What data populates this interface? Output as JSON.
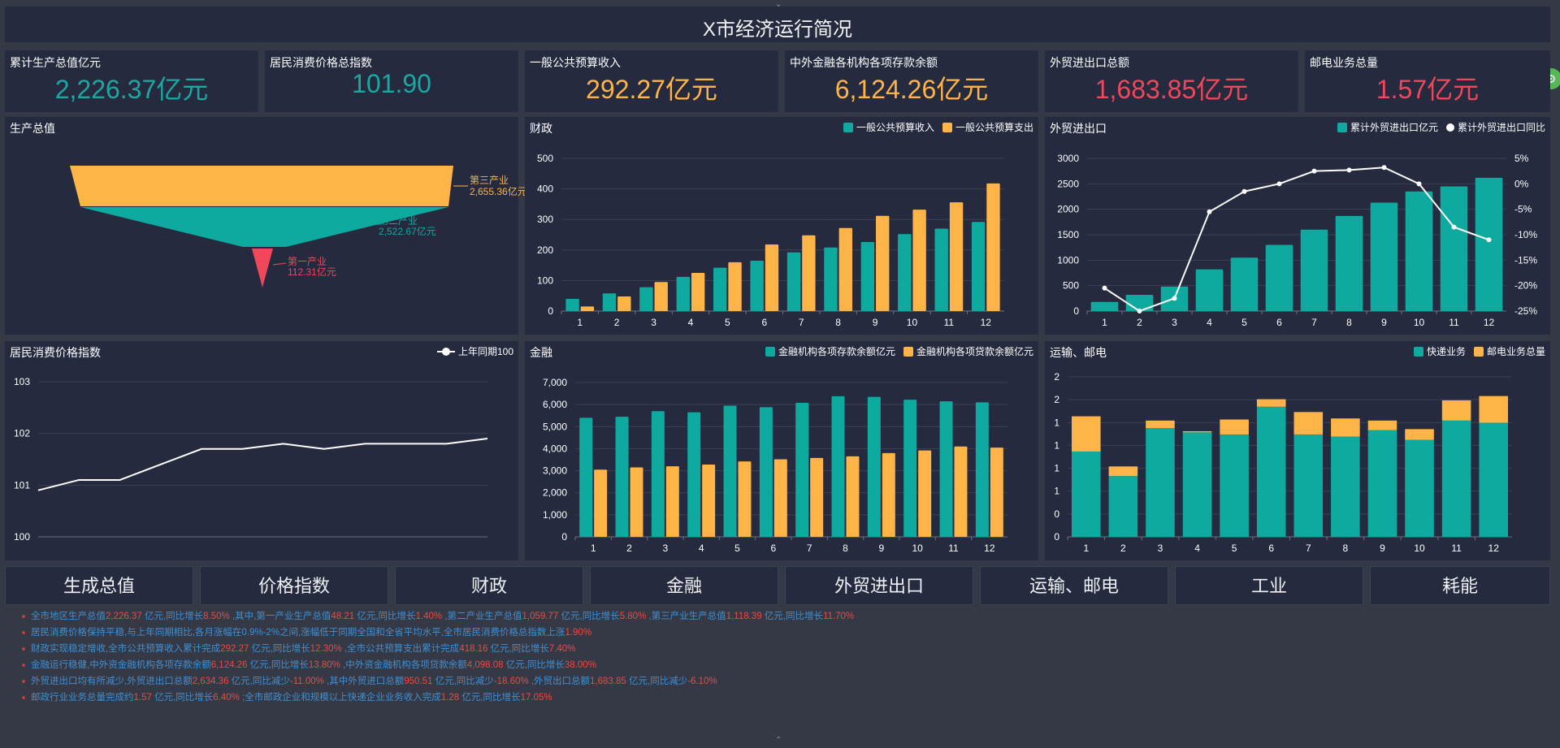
{
  "header": {
    "title": "X市经济运行简况"
  },
  "kpis": [
    {
      "label": "累计生产总值亿元",
      "value": "2,226.37亿元",
      "color": "#1aa8a0"
    },
    {
      "label": "居民消费价格总指数",
      "value": "101.90",
      "color": "#1aa8a0"
    },
    {
      "label": "一般公共预算收入",
      "value": "292.27亿元",
      "color": "#ffb447"
    },
    {
      "label": "中外金融各机构各项存款余额",
      "value": "6,124.26亿元",
      "color": "#ffb447"
    },
    {
      "label": "外贸进出口总额",
      "value": "1,683.85亿元",
      "color": "#f0475a"
    },
    {
      "label": "邮电业务总量",
      "value": "1.57亿元",
      "color": "#f0475a"
    }
  ],
  "colors": {
    "teal": "#0eaaa0",
    "orange": "#ffb447",
    "red": "#f0475a",
    "white": "#ffffff",
    "grid": "#3c4256"
  },
  "nav": [
    "生成总值",
    "价格指数",
    "财政",
    "金融",
    "外贸进出口",
    "运输、邮电",
    "工业",
    "耗能"
  ],
  "chart_data": [
    {
      "id": "gdp",
      "type": "funnel",
      "title": "生产总值",
      "stages": [
        {
          "name": "第三产业",
          "value": 2655.36,
          "label": "2,655.36亿元",
          "color": "#ffb447"
        },
        {
          "name": "第二产业",
          "value": 2522.67,
          "label": "2,522.67亿元",
          "color": "#0eaaa0"
        },
        {
          "name": "第一产业",
          "value": 112.31,
          "label": "112.31亿元",
          "color": "#f0475a"
        }
      ]
    },
    {
      "id": "finance",
      "type": "bar",
      "title": "财政",
      "categories": [
        "1",
        "2",
        "3",
        "4",
        "5",
        "6",
        "7",
        "8",
        "9",
        "10",
        "11",
        "12"
      ],
      "series": [
        {
          "name": "一般公共预算收入",
          "color": "#0eaaa0",
          "values": [
            40,
            58,
            78,
            112,
            142,
            165,
            192,
            208,
            226,
            252,
            270,
            292
          ]
        },
        {
          "name": "一般公共预算支出",
          "color": "#ffb447",
          "values": [
            15,
            48,
            95,
            125,
            160,
            218,
            248,
            272,
            312,
            332,
            356,
            418
          ]
        }
      ],
      "ylim": [
        0,
        500
      ],
      "yticks": [
        "0",
        "100",
        "200",
        "300",
        "400",
        "500"
      ],
      "grid": true,
      "legend": "top-right"
    },
    {
      "id": "trade",
      "type": "bar+line",
      "title": "外贸进出口",
      "categories": [
        "1",
        "2",
        "3",
        "4",
        "5",
        "6",
        "7",
        "8",
        "9",
        "10",
        "11",
        "12"
      ],
      "series": [
        {
          "name": "累计外贸进出口亿元",
          "color": "#0eaaa0",
          "axis": "left",
          "values": [
            180,
            320,
            480,
            820,
            1050,
            1300,
            1600,
            1870,
            2130,
            2350,
            2450,
            2620
          ]
        },
        {
          "name": "累计外贸进出口同比",
          "color": "#ffffff",
          "axis": "right",
          "kind": "line",
          "values": [
            -20.5,
            -25,
            -22.5,
            -5.5,
            -1.5,
            0,
            2.5,
            2.7,
            3.2,
            0,
            -8.5,
            -11
          ]
        }
      ],
      "ylim_left": [
        0,
        3000
      ],
      "yticks_left": [
        "0",
        "500",
        "1000",
        "1500",
        "2000",
        "2500",
        "3000"
      ],
      "ylim_right": [
        -25,
        5
      ],
      "yticks_right": [
        "-25%",
        "-20%",
        "-15%",
        "-10%",
        "-5%",
        "0%",
        "5%"
      ],
      "grid": true,
      "legend": "top-right"
    },
    {
      "id": "cpi",
      "type": "line",
      "title": "居民消费价格指数",
      "categories": [
        "1",
        "2",
        "3",
        "4",
        "5",
        "6",
        "7",
        "8",
        "9",
        "10",
        "11",
        "12"
      ],
      "series": [
        {
          "name": "上年同期100",
          "color": "#ffffff",
          "values": [
            100.9,
            101.1,
            101.1,
            101.4,
            101.7,
            101.7,
            101.8,
            101.7,
            101.8,
            101.8,
            101.8,
            101.9
          ]
        }
      ],
      "ylim": [
        100,
        103
      ],
      "yticks": [
        "100",
        "101",
        "102",
        "103"
      ],
      "grid": true,
      "legend": "top-right"
    },
    {
      "id": "banking",
      "type": "bar",
      "title": "金融",
      "categories": [
        "1",
        "2",
        "3",
        "4",
        "5",
        "6",
        "7",
        "8",
        "9",
        "10",
        "11",
        "12"
      ],
      "series": [
        {
          "name": "金融机构各项存款余额亿元",
          "color": "#0eaaa0",
          "values": [
            5400,
            5450,
            5700,
            5650,
            5950,
            5880,
            6080,
            6380,
            6350,
            6220,
            6150,
            6100
          ]
        },
        {
          "name": "金融机构各项贷款余额亿元",
          "color": "#ffb447",
          "values": [
            3050,
            3150,
            3200,
            3280,
            3420,
            3520,
            3580,
            3650,
            3800,
            3920,
            4100,
            4050
          ]
        }
      ],
      "ylim": [
        0,
        7000
      ],
      "yticks": [
        "0",
        "1,000",
        "2,000",
        "3,000",
        "4,000",
        "5,000",
        "6,000",
        "7,000"
      ],
      "grid": true,
      "legend": "top-right"
    },
    {
      "id": "transport",
      "type": "stacked-bar",
      "title": "运输、邮电",
      "categories": [
        "1",
        "2",
        "3",
        "4",
        "5",
        "6",
        "7",
        "8",
        "9",
        "10",
        "11",
        "12"
      ],
      "series": [
        {
          "name": "快递业务",
          "color": "#0eaaa0",
          "values": [
            0.8,
            0.57,
            1.02,
            0.98,
            0.96,
            1.22,
            0.96,
            0.94,
            1.0,
            0.91,
            1.09,
            1.07
          ]
        },
        {
          "name": "邮电业务总量",
          "color": "#ffb447",
          "values": [
            0.33,
            0.09,
            0.07,
            0.01,
            0.14,
            0.07,
            0.21,
            0.17,
            0.09,
            0.1,
            0.19,
            0.25
          ]
        }
      ],
      "ylim": [
        0,
        1.5
      ],
      "yticks": [
        "0",
        "0",
        "1",
        "1",
        "1",
        "1",
        "2",
        "2"
      ],
      "grid": true,
      "legend": "top-right"
    }
  ],
  "notes": [
    [
      [
        "全市地区生产总值",
        0
      ],
      [
        "2,226.37",
        1
      ],
      [
        " 亿元,同比增长",
        0
      ],
      [
        "8.50%",
        1
      ],
      [
        " ,其中,第一产业生产总值",
        0
      ],
      [
        "48.21",
        1
      ],
      [
        " 亿元,同比增长",
        0
      ],
      [
        "1.40%",
        1
      ],
      [
        " ,第二产业生产总值",
        0
      ],
      [
        "1,059.77",
        1
      ],
      [
        " 亿元,同比增长",
        0
      ],
      [
        "5.80%",
        1
      ],
      [
        " ,第三产业生产总值",
        0
      ],
      [
        "1,118.39",
        1
      ],
      [
        " 亿元,同比增长",
        0
      ],
      [
        "11.70%",
        1
      ]
    ],
    [
      [
        "居民消费价格保持平稳,与上年同期相比,各月涨幅在0.9%-2%之间,涨幅低于同期全国和全省平均水平,全市居民消费价格总指数上涨",
        0
      ],
      [
        "1.90%",
        1
      ]
    ],
    [
      [
        "财政实现稳定增收,全市公共预算收入累计完成",
        0
      ],
      [
        "292.27",
        1
      ],
      [
        " 亿元,同比增长",
        0
      ],
      [
        "12.30%",
        1
      ],
      [
        " ,全市公共预算支出累计完成",
        0
      ],
      [
        "418.16",
        1
      ],
      [
        " 亿元,同比增长",
        0
      ],
      [
        "7.40%",
        1
      ]
    ],
    [
      [
        "金融运行稳健,中外资金融机构各项存款余额",
        0
      ],
      [
        "6,124.26",
        1
      ],
      [
        " 亿元,同比增长",
        0
      ],
      [
        "13.80%",
        1
      ],
      [
        " ,中外资金融机构各项贷款余额",
        0
      ],
      [
        "4,098.08",
        1
      ],
      [
        " 亿元,同比增长",
        0
      ],
      [
        "38.00%",
        1
      ]
    ],
    [
      [
        "外贸进出口均有所减少,外贸进出口总额",
        0
      ],
      [
        "2,634.36",
        1
      ],
      [
        " 亿元,同比减少",
        0
      ],
      [
        "-11.00%",
        1
      ],
      [
        " ,其中外贸进口总额",
        0
      ],
      [
        "950.51",
        1
      ],
      [
        " 亿元,同比减少",
        0
      ],
      [
        "-18.60%",
        1
      ],
      [
        " ,外贸出口总额",
        0
      ],
      [
        "1,683.85",
        1
      ],
      [
        " 亿元,同比减少",
        0
      ],
      [
        "-6.10%",
        1
      ]
    ],
    [
      [
        "邮政行业业务总量完成约",
        0
      ],
      [
        "1.57",
        1
      ],
      [
        " 亿元,同比增长",
        0
      ],
      [
        "6.40%",
        1
      ],
      [
        " ;全市邮政企业和规模以上快递企业业务收入完成",
        0
      ],
      [
        "1.28",
        1
      ],
      [
        " 亿元,同比增长",
        0
      ],
      [
        "17.05%",
        1
      ]
    ]
  ]
}
